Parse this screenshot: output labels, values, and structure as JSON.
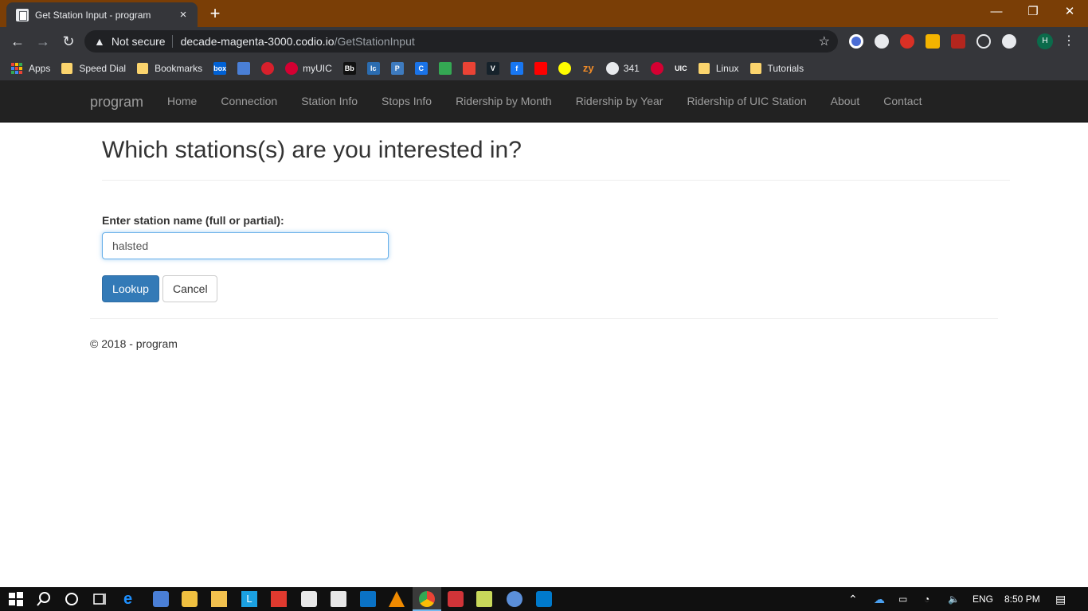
{
  "browser": {
    "tab_title": "Get Station Input - program",
    "tab_close": "×",
    "new_tab": "+",
    "window_minimize": "—",
    "window_restore": "❐",
    "window_close": "✕",
    "back": "←",
    "forward": "→",
    "reload": "↻",
    "security_label": "Not secure",
    "url_host": "decade-magenta-3000.codio.io",
    "url_path": "/GetStationInput",
    "profile_initial": "H"
  },
  "bookmarks": [
    {
      "label": "Apps",
      "icon": "apps-grid-icon"
    },
    {
      "label": "Speed Dial",
      "icon": "folder-icon"
    },
    {
      "label": "Bookmarks",
      "icon": "folder-icon"
    },
    {
      "label": "",
      "icon": "box-icon",
      "text": "box",
      "color": "#0061d5"
    },
    {
      "label": "",
      "icon": "doc-icon",
      "color": "#4a7fd6"
    },
    {
      "label": "",
      "icon": "stop-icon",
      "color": "#d8202c"
    },
    {
      "label": "myUIC",
      "icon": "uic-icon",
      "color": "#d50032"
    },
    {
      "label": "",
      "icon": "blackboard-icon",
      "text": "Bb",
      "color": "#111111"
    },
    {
      "label": "",
      "icon": "lc-icon",
      "text": "lc",
      "color": "#2b6cb0"
    },
    {
      "label": "",
      "icon": "piazza-icon",
      "text": "P",
      "color": "#3e7bbf"
    },
    {
      "label": "",
      "icon": "codio-icon",
      "text": "C",
      "color": "#1a73e8"
    },
    {
      "label": "",
      "icon": "drive-icon",
      "color": "#34a853"
    },
    {
      "label": "",
      "icon": "gmail-icon",
      "color": "#ea4335"
    },
    {
      "label": "",
      "icon": "vimeo-icon",
      "text": "V",
      "color": "#16222b"
    },
    {
      "label": "",
      "icon": "facebook-icon",
      "text": "f",
      "color": "#1877f2"
    },
    {
      "label": "",
      "icon": "youtube-icon",
      "color": "#ff0000"
    },
    {
      "label": "",
      "icon": "snapchat-icon",
      "color": "#fffc00"
    },
    {
      "label": "",
      "icon": "zybooks-icon",
      "text": "zy",
      "color": "#f28c28"
    },
    {
      "label": "341",
      "icon": "globe-icon",
      "color": "#e8eaed"
    },
    {
      "label": "",
      "icon": "uic-icon-2",
      "color": "#d50032"
    },
    {
      "label": "",
      "icon": "uic-logo-icon",
      "text": "UIC",
      "color": "#35363a"
    },
    {
      "label": "Linux",
      "icon": "folder-icon"
    },
    {
      "label": "Tutorials",
      "icon": "folder-icon"
    }
  ],
  "nav": {
    "brand": "program",
    "links": [
      "Home",
      "Connection",
      "Station Info",
      "Stops Info",
      "Ridership by Month",
      "Ridership by Year",
      "Ridership of UIC Station",
      "About",
      "Contact"
    ]
  },
  "main": {
    "title": "Which stations(s) are you interested in?",
    "field_label": "Enter station name (full or partial):",
    "field_value": "halsted",
    "lookup_label": "Lookup",
    "cancel_label": "Cancel",
    "footer": "© 2018 - program"
  },
  "taskbar": {
    "language": "ENG",
    "time": "8:50 PM"
  },
  "colors": {
    "titlebar": "#7a3e06",
    "chrome_dark": "#35363a",
    "navbar": "#222222",
    "primary": "#337ab7"
  }
}
